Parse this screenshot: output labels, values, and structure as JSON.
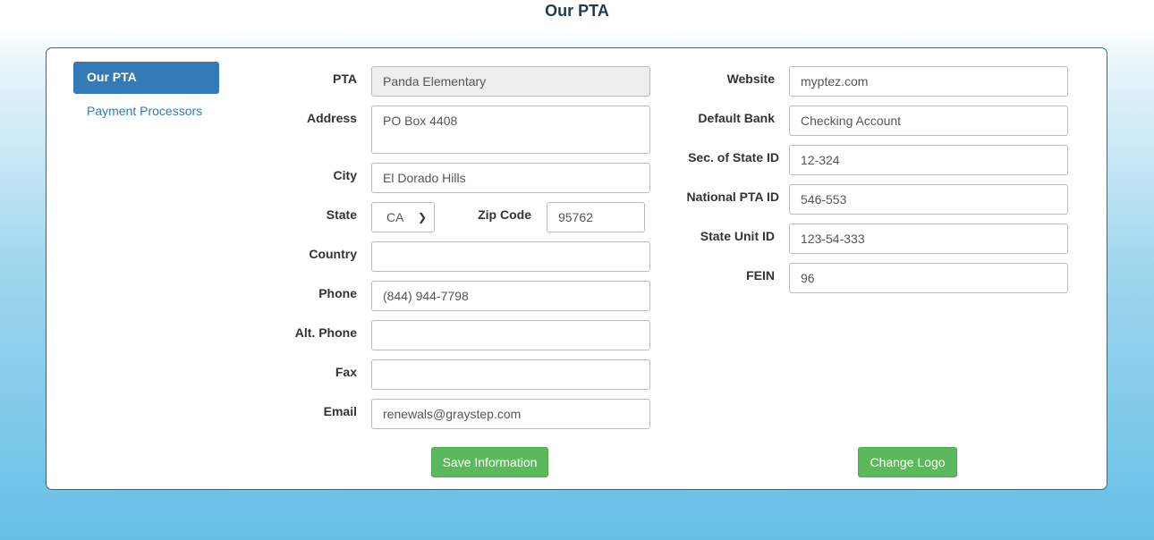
{
  "header": {
    "title": "Our PTA"
  },
  "sidebar": {
    "items": [
      {
        "label": "Our PTA"
      },
      {
        "label": "Payment Processors"
      }
    ]
  },
  "form_left": {
    "pta": {
      "label": "PTA",
      "value": "Panda Elementary"
    },
    "address": {
      "label": "Address",
      "value": "PO Box 4408"
    },
    "city": {
      "label": "City",
      "value": "El Dorado Hills"
    },
    "state": {
      "label": "State",
      "value": "CA"
    },
    "zip": {
      "label": "Zip Code",
      "value": "95762"
    },
    "country": {
      "label": "Country",
      "value": ""
    },
    "phone": {
      "label": "Phone",
      "value": "(844) 944-7798"
    },
    "alt_phone": {
      "label": "Alt. Phone",
      "value": ""
    },
    "fax": {
      "label": "Fax",
      "value": ""
    },
    "email": {
      "label": "Email",
      "value": "renewals@graystep.com"
    }
  },
  "form_right": {
    "website": {
      "label": "Website",
      "value": "myptez.com"
    },
    "default_bank": {
      "label": "Default Bank",
      "value": "Checking Account"
    },
    "sos_id": {
      "label": "Sec. of State ID",
      "value": "12-324"
    },
    "national_pta_id": {
      "label": "National PTA ID",
      "value": "546-553"
    },
    "state_unit_id": {
      "label": "State Unit ID",
      "value": "123-54-333"
    },
    "fein": {
      "label": "FEIN",
      "value": "96"
    }
  },
  "buttons": {
    "save_label": "Save Information",
    "change_logo_label": "Change Logo"
  },
  "colors": {
    "primary": "#337ab7",
    "success": "#5cb85c",
    "panel_border": "#2f6a87"
  }
}
